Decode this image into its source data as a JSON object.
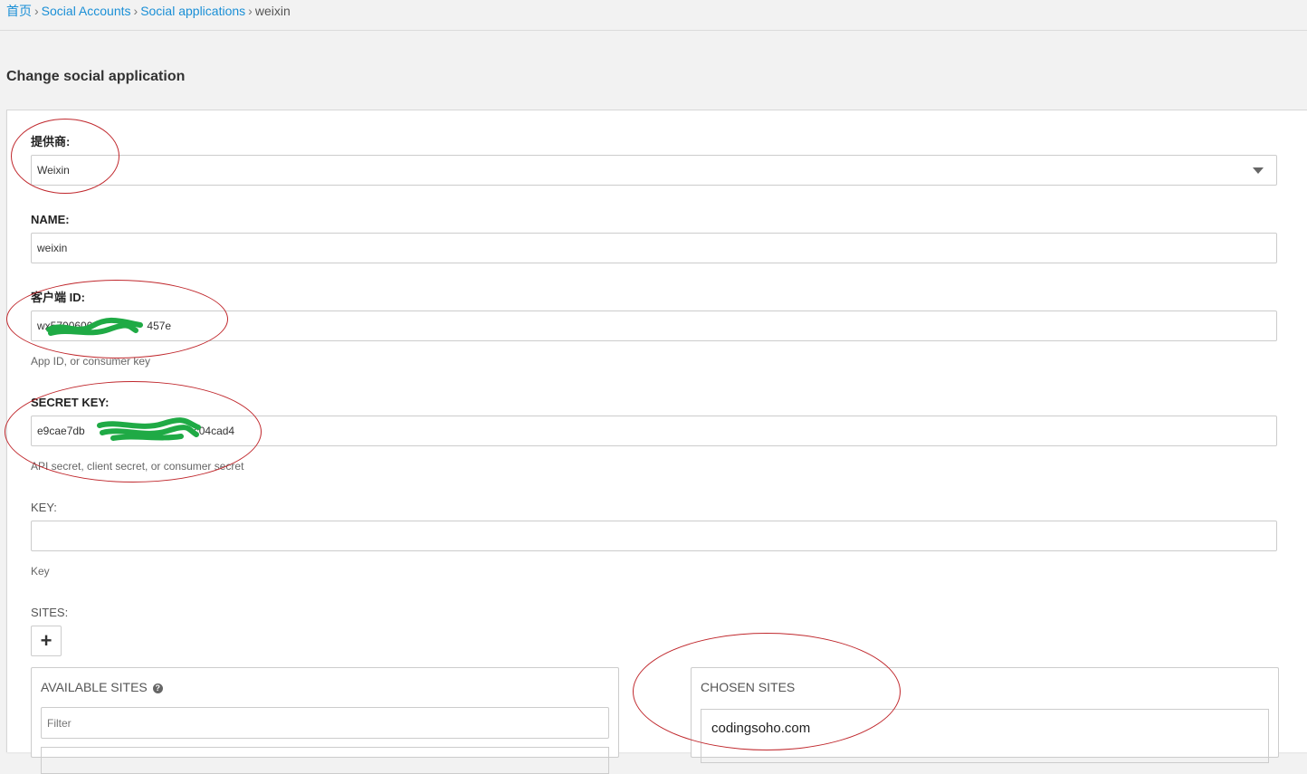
{
  "breadcrumb": {
    "home": "首页",
    "social_accounts": "Social Accounts",
    "social_applications": "Social applications",
    "current": "weixin",
    "separator": "›"
  },
  "page_title": "Change social application",
  "form": {
    "provider": {
      "label": "提供商:",
      "value": "Weixin"
    },
    "name": {
      "label": "NAME:",
      "value": "weixin"
    },
    "client_id": {
      "label": "客户端 ID:",
      "value": "wx5700600",
      "value_tail": "457e",
      "help": "App ID, or consumer key"
    },
    "secret_key": {
      "label": "SECRET KEY:",
      "value": "e9cae7db",
      "value_tail": "c04cad4",
      "help": "API secret, client secret, or consumer secret"
    },
    "key": {
      "label": "KEY:",
      "value": "",
      "help": "Key"
    },
    "sites": {
      "label": "SITES:",
      "add_icon": "plus-icon",
      "add_glyph": "+",
      "available": {
        "title": "AVAILABLE SITES",
        "help_icon": "question-circle-icon",
        "help_glyph": "?",
        "filter_placeholder": "Filter"
      },
      "chosen": {
        "title": "CHOSEN SITES",
        "items": [
          "codingsoho.com"
        ]
      }
    }
  },
  "colors": {
    "link": "#1a8fd6",
    "annotation": "#c0282d",
    "redaction": "#1faa45"
  }
}
